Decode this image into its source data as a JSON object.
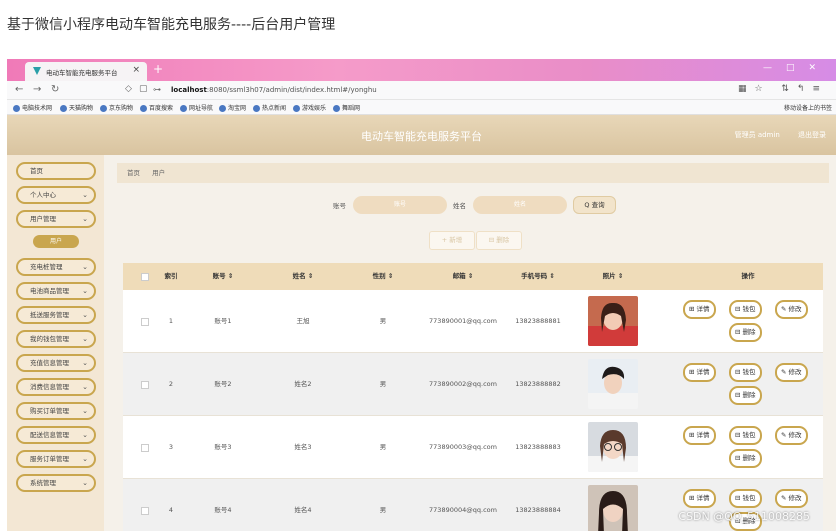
{
  "caption": "基于微信小程序电动车智能充电服务----后台用户管理",
  "browser": {
    "tab_title": "电动车智能充电服务平台",
    "tab_close": "×",
    "new_tab": "+",
    "url_host": "localhost",
    "url_rest": ":8080/ssml3h07/admin/dist/index.html#/yonghu",
    "bookmarks": [
      "电脑技术网",
      "天猫购物",
      "京东购物",
      "百度搜索",
      "网址导航",
      "淘宝网",
      "热点新闻",
      "游戏娱乐",
      "舞蹈网"
    ],
    "bookmark_right": "移动设备上的书签"
  },
  "app": {
    "title": "电动车智能充电服务平台",
    "user_label": "管理员 admin",
    "logout": "退出登录"
  },
  "sidebar": {
    "items": [
      {
        "label": "首页",
        "chevron": ""
      },
      {
        "label": "个人中心",
        "chevron": "⌄"
      },
      {
        "label": "用户管理",
        "chevron": "⌄"
      },
      {
        "label": "充电桩管理",
        "chevron": "⌄"
      },
      {
        "label": "电池商品管理",
        "chevron": "⌄"
      },
      {
        "label": "抵送服务管理",
        "chevron": "⌄"
      },
      {
        "label": "我的钱包管理",
        "chevron": "⌄"
      },
      {
        "label": "充值信息管理",
        "chevron": "⌄"
      },
      {
        "label": "消费信息管理",
        "chevron": "⌄"
      },
      {
        "label": "购买订单管理",
        "chevron": "⌄"
      },
      {
        "label": "配送信息管理",
        "chevron": "⌄"
      },
      {
        "label": "服务订单管理",
        "chevron": "⌄"
      },
      {
        "label": "系统管理",
        "chevron": "⌄"
      }
    ],
    "submenu_active": "用户"
  },
  "breadcrumb": [
    "首页",
    "用户"
  ],
  "search": {
    "account_label": "账号",
    "account_placeholder": "账号",
    "name_label": "姓名",
    "name_placeholder": "姓名",
    "query_button": "Q 查询"
  },
  "actions": {
    "add": "+ 新增",
    "delete": "⊟ 删除"
  },
  "table": {
    "headers": [
      "索引",
      "账号 ⇕",
      "姓名 ⇕",
      "性别 ⇕",
      "邮箱 ⇕",
      "手机号码 ⇕",
      "照片 ⇕",
      "操作"
    ],
    "rows": [
      {
        "index": "1",
        "account": "账号1",
        "name": "王旭",
        "gender": "男",
        "email": "773890001@qq.com",
        "phone": "13823888881"
      },
      {
        "index": "2",
        "account": "账号2",
        "name": "姓名2",
        "gender": "男",
        "email": "773890002@qq.com",
        "phone": "13823888882"
      },
      {
        "index": "3",
        "account": "账号3",
        "name": "姓名3",
        "gender": "男",
        "email": "773890003@qq.com",
        "phone": "13823888883"
      },
      {
        "index": "4",
        "account": "账号4",
        "name": "姓名4",
        "gender": "男",
        "email": "773890004@qq.com",
        "phone": "13823888884"
      }
    ],
    "op_buttons": {
      "detail": "⊞ 详情",
      "wallet": "⊟ 钱包",
      "edit": "✎ 修改",
      "remove": "⊟ 删除"
    }
  },
  "watermark": "CSDN @QQ_511008285",
  "colors": {
    "accent": "#c9a64e",
    "header": "#e3cfac",
    "sidebar": "#f3e7d4"
  }
}
